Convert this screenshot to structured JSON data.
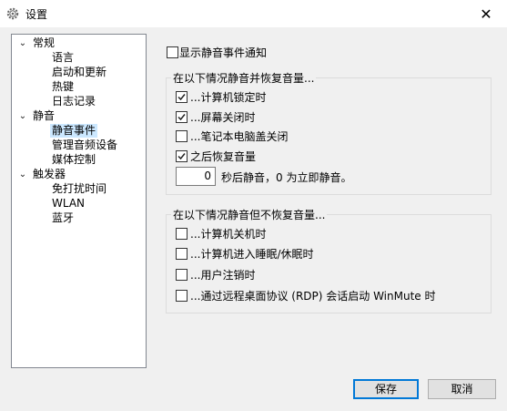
{
  "window": {
    "title": "设置",
    "icon": "gear-icon",
    "close_glyph": "✕"
  },
  "tree": {
    "collapse_glyph": "⌄",
    "groups": [
      {
        "label": "常规",
        "children": [
          "语言",
          "启动和更新",
          "热键",
          "日志记录"
        ]
      },
      {
        "label": "静音",
        "children": [
          "静音事件",
          "管理音频设备",
          "媒体控制"
        ]
      },
      {
        "label": "触发器",
        "children": [
          "免打扰时间",
          "WLAN",
          "蓝牙"
        ]
      }
    ],
    "selected": "静音事件"
  },
  "main": {
    "show_notification": {
      "label": "显示静音事件通知",
      "checked": false
    },
    "group1": {
      "title": "在以下情况静音并恢复音量...",
      "items": [
        {
          "label": "...计算机锁定时",
          "checked": true
        },
        {
          "label": "...屏幕关闭时",
          "checked": true
        },
        {
          "label": "...笔记本电脑盖关闭",
          "checked": false
        },
        {
          "label": "之后恢复音量",
          "checked": true
        }
      ],
      "delay_value": "0",
      "delay_text": "秒后静音，0 为立即静音。"
    },
    "group2": {
      "title": "在以下情况静音但不恢复音量...",
      "items": [
        {
          "label": "...计算机关机时",
          "checked": false
        },
        {
          "label": "...计算机进入睡眠/休眠时",
          "checked": false
        },
        {
          "label": "...用户注销时",
          "checked": false
        },
        {
          "label": "...通过远程桌面协议 (RDP) 会话启动 WinMute 时",
          "checked": false
        }
      ]
    }
  },
  "buttons": {
    "save": "保存",
    "cancel": "取消"
  },
  "colors": {
    "accent": "#0078d7",
    "selection": "#cce8ff"
  }
}
